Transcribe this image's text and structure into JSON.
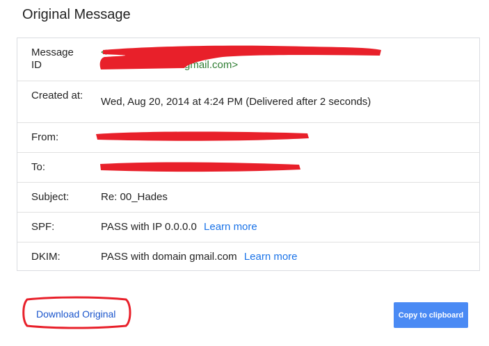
{
  "page": {
    "title": "Original Message"
  },
  "details": {
    "rows": [
      {
        "label": "Message ID",
        "value_prefix": "<",
        "value_suffix": "gmail.com>"
      },
      {
        "label": "Created at:",
        "value": "Wed, Aug 20, 2014 at 4:24 PM (Delivered after 2 seconds)"
      },
      {
        "label": "From:",
        "value": ""
      },
      {
        "label": "To:",
        "value": ""
      },
      {
        "label": "Subject:",
        "value": "Re: 00_Hades"
      },
      {
        "label": "SPF:",
        "value": "PASS with IP 0.0.0.0",
        "link": "Learn more"
      },
      {
        "label": "DKIM:",
        "value": "PASS with domain gmail.com",
        "link": "Learn more"
      }
    ]
  },
  "actions": {
    "download_label": "Download Original",
    "copy_label": "Copy to clipboard"
  },
  "colors": {
    "link": "#1a73e8",
    "message_id": "#2e7d32",
    "button": "#4a8af4",
    "redaction": "#e8202a"
  }
}
